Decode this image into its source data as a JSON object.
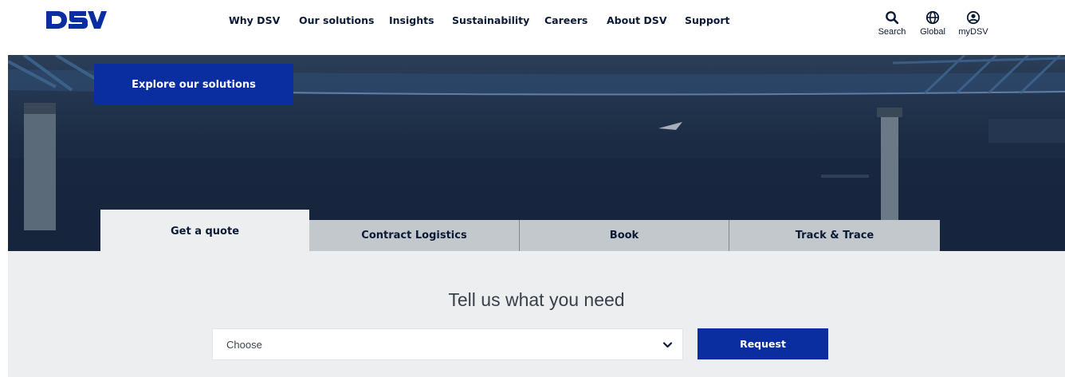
{
  "brand": {
    "logo_text": "DSV",
    "accent": "#0a2ea0"
  },
  "nav": {
    "items": [
      {
        "label": "Why DSV"
      },
      {
        "label": "Our solutions"
      },
      {
        "label": "Insights"
      },
      {
        "label": "Sustainability"
      },
      {
        "label": "Careers"
      },
      {
        "label": "About DSV"
      },
      {
        "label": "Support"
      }
    ]
  },
  "utility": {
    "search": {
      "label": "Search",
      "icon": "search-icon"
    },
    "global": {
      "label": "Global",
      "icon": "globe-icon"
    },
    "account": {
      "label": "myDSV",
      "icon": "user-icon"
    }
  },
  "hero": {
    "cta_label": "Explore our solutions"
  },
  "tabs": [
    {
      "label": "Get a quote",
      "active": true
    },
    {
      "label": "Contract Logistics",
      "active": false
    },
    {
      "label": "Book",
      "active": false
    },
    {
      "label": "Track & Trace",
      "active": false
    }
  ],
  "quote_form": {
    "title": "Tell us what you need",
    "select_value": "Choose",
    "submit_label": "Request"
  }
}
